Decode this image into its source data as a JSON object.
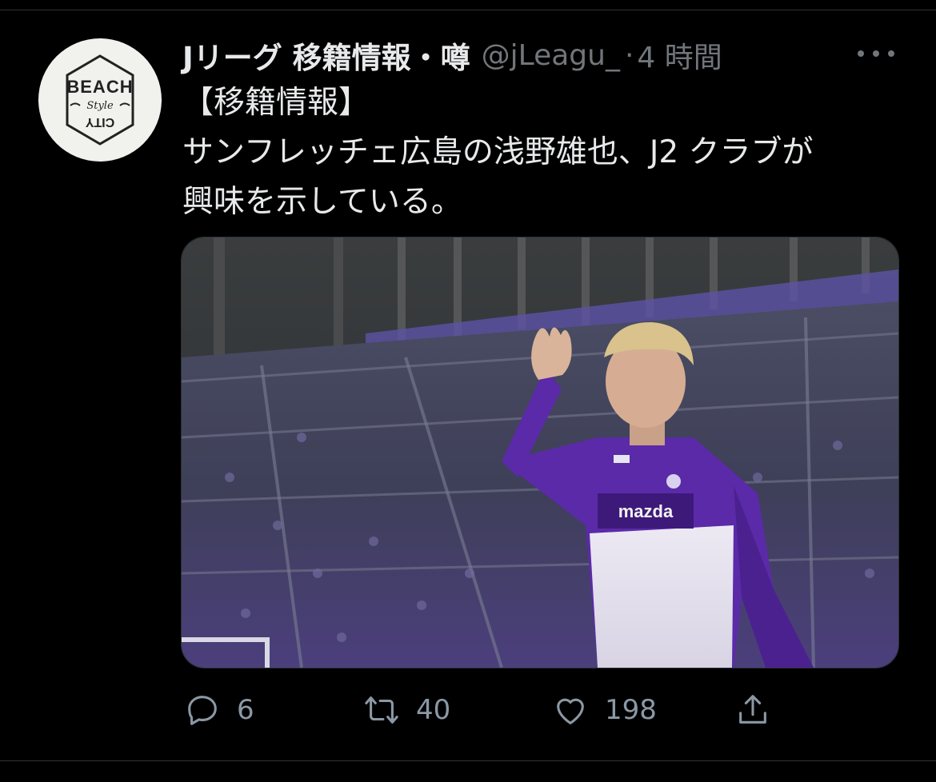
{
  "tweet": {
    "display_name": "Jリーグ 移籍情報・噂",
    "handle": "@jLeagu_",
    "separator": "·",
    "time": "4 時間",
    "text_lines": [
      "【移籍情報】",
      "サンフレッチェ広島の浅野雄也、J2 クラブが",
      "興味を示している。"
    ]
  },
  "avatar": {
    "logo_top": "BEACH",
    "logo_middle": "Style",
    "logo_bottom": "CITY",
    "icon": "beach-city-logo-icon"
  },
  "media": {
    "jersey_text": "mazda",
    "icon": "player-photo"
  },
  "actions": {
    "reply_count": "6",
    "retweet_count": "40",
    "like_count": "198",
    "reply_icon": "reply-icon",
    "retweet_icon": "retweet-icon",
    "like_icon": "heart-icon",
    "share_icon": "share-icon"
  },
  "colors": {
    "background": "#000000",
    "text": "#e7e9ea",
    "muted": "#71767b",
    "club_purple": "#5b2aa8"
  }
}
